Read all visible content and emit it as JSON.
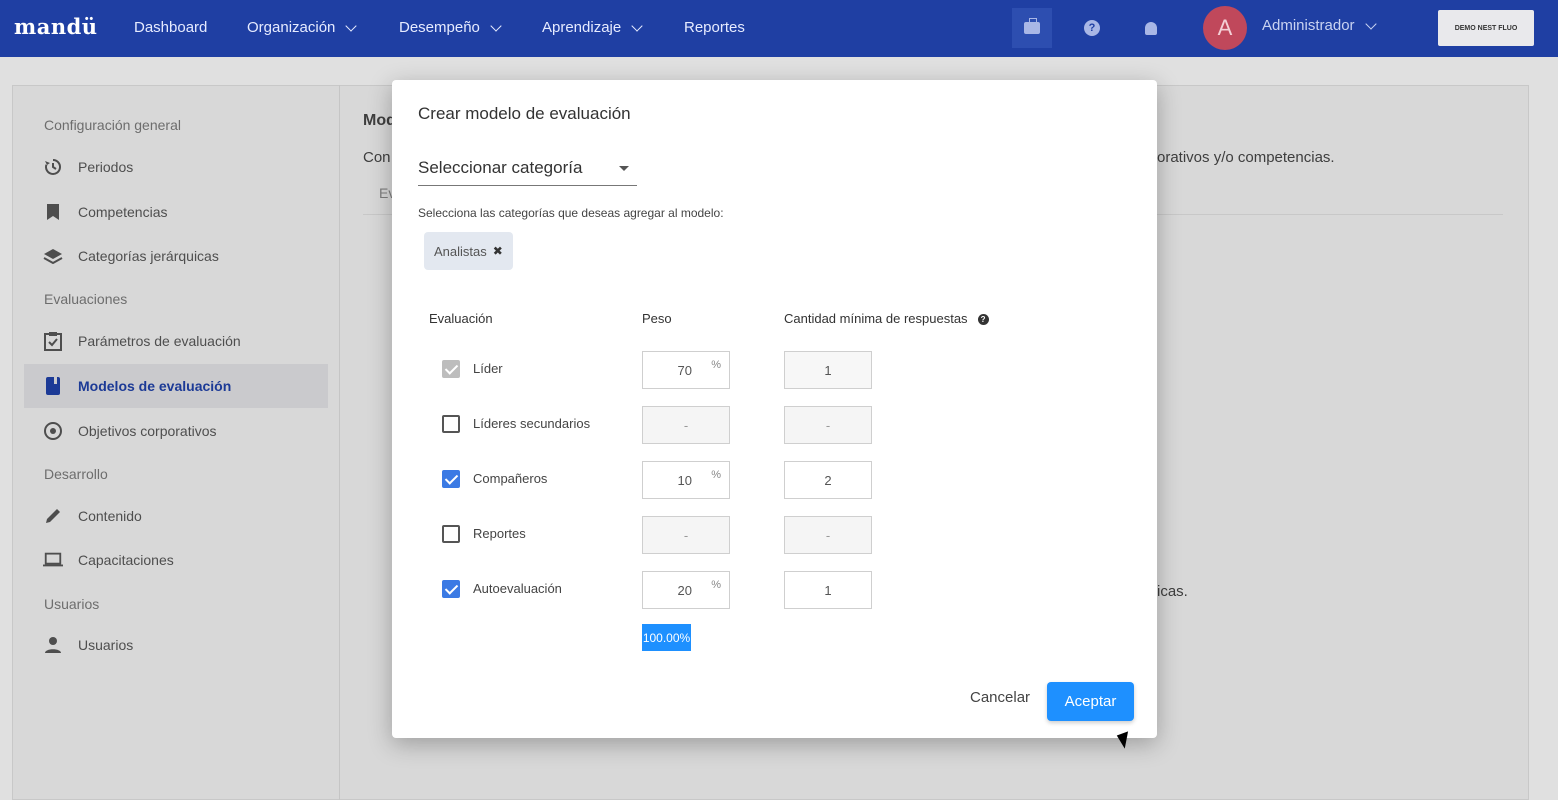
{
  "app": {
    "logo": "mandü",
    "nav": [
      "Dashboard",
      "Organización",
      "Desempeño",
      "Aprendizaje",
      "Reportes"
    ],
    "user_initial": "A",
    "user_name": "Administrador",
    "demo_label": "DEMO NEST FLUO",
    "icons": [
      "briefcase-icon",
      "help-icon",
      "bell-icon"
    ]
  },
  "sidebar": {
    "sections": [
      {
        "heading": "Configuración general",
        "items": [
          "Periodos",
          "Competencias",
          "Categorías jerárquicas"
        ]
      },
      {
        "heading": "Evaluaciones",
        "items": [
          "Parámetros de evaluación",
          "Modelos de evaluación",
          "Objetivos corporativos"
        ]
      },
      {
        "heading": "Desarrollo",
        "items": [
          "Contenido",
          "Capacitaciones"
        ]
      },
      {
        "heading": "Usuarios",
        "items": [
          "Usuarios"
        ]
      }
    ],
    "active_item": "Modelos de evaluación"
  },
  "background": {
    "title_fragment": "Mod",
    "text_fragment_1": "Con",
    "text_fragment_2": "orativos y/o competencias.",
    "text_fragment_3": "Ev",
    "text_fragment_4": "icas."
  },
  "modal": {
    "title": "Crear modelo de evaluación",
    "select_label": "Seleccionar categoría",
    "helper": "Selecciona las categorías que deseas agregar al modelo:",
    "chip": "Analistas",
    "chip_remove": "✖",
    "columns": {
      "evaluacion": "Evaluación",
      "peso": "Peso",
      "cantidad": "Cantidad mínima de respuestas"
    },
    "rows": [
      {
        "label": "Líder",
        "state": "disabled-checked",
        "peso": "70",
        "pct": "%",
        "cantidad": "1"
      },
      {
        "label": "Líderes secundarios",
        "state": "unchecked",
        "peso": "-",
        "pct": "",
        "cantidad": "-"
      },
      {
        "label": "Compañeros",
        "state": "checked",
        "peso": "10",
        "pct": "%",
        "cantidad": "2"
      },
      {
        "label": "Reportes",
        "state": "unchecked",
        "peso": "-",
        "pct": "",
        "cantidad": "-"
      },
      {
        "label": "Autoevaluación",
        "state": "checked",
        "peso": "20",
        "pct": "%",
        "cantidad": "1"
      }
    ],
    "total": "100.00%",
    "cancel": "Cancelar",
    "accept": "Aceptar"
  }
}
